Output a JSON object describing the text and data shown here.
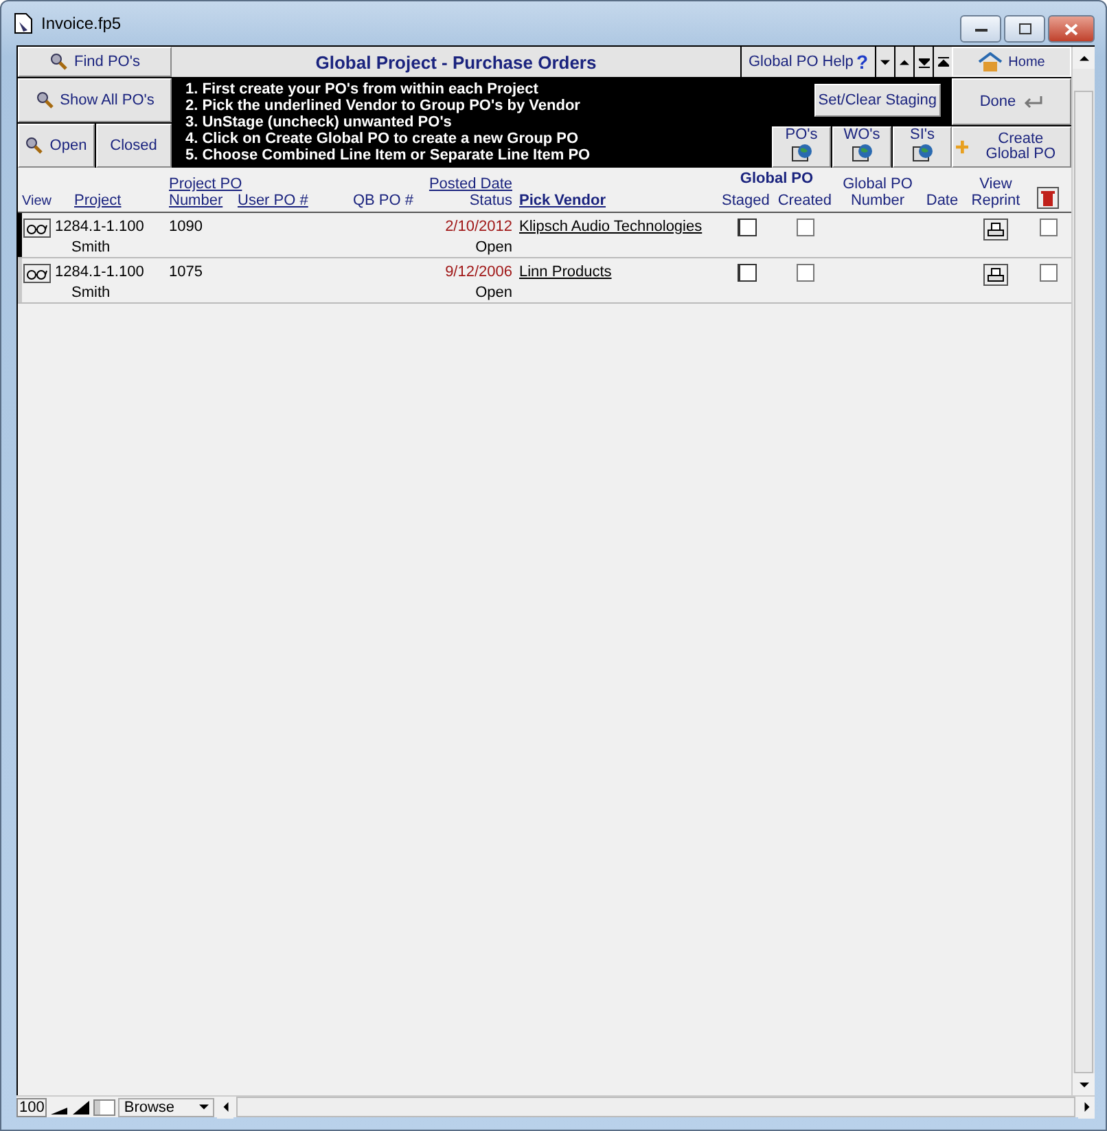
{
  "window": {
    "title": "Invoice.fp5"
  },
  "left_buttons": {
    "find": "Find PO's",
    "show_all": "Show All PO's",
    "open": "Open",
    "closed": "Closed"
  },
  "header": {
    "title": "Global Project - Purchase Orders",
    "help": "Global PO Help",
    "help_mark": "?",
    "home": "Home"
  },
  "instructions": [
    "1. First create your PO's from within each Project",
    "2. Pick the underlined Vendor to Group PO's by Vendor",
    "3. UnStage (uncheck) unwanted PO's",
    "4. Click on Create Global PO to create a new Group PO",
    "5. Choose Combined Line Item or Separate Line Item PO"
  ],
  "actions": {
    "staging": "Set/Clear Staging",
    "done": "Done",
    "create": "Create Global PO",
    "reports": [
      "PO's",
      "WO's",
      "SI's"
    ]
  },
  "columns": {
    "view": "View",
    "project": "Project",
    "project_po": "Project PO",
    "number": "Number",
    "user_po": "User PO #",
    "qb_po": "QB PO #",
    "posted_date": "Posted Date",
    "status": "Status",
    "vendor": "Pick Vendor",
    "global_po": "Global PO",
    "staged": "Staged",
    "created": "Created",
    "gpo_top": "Global PO",
    "gpo_number": "Number",
    "date": "Date",
    "view_top": "View",
    "reprint": "Reprint"
  },
  "rows": [
    {
      "selected": true,
      "project": "1284.1-1.100",
      "name": "Smith",
      "number": "1090",
      "date": "2/10/2012",
      "status": "Open",
      "vendor": "Klipsch Audio Technologies",
      "staged": false,
      "created": false,
      "delete": false
    },
    {
      "selected": false,
      "project": "1284.1-1.100",
      "name": "Smith",
      "number": "1075",
      "date": "9/12/2006",
      "status": "Open",
      "vendor": "Linn Products",
      "staged": false,
      "created": false,
      "delete": false
    }
  ],
  "status_bar": {
    "zoom": "100",
    "mode": "Browse"
  }
}
